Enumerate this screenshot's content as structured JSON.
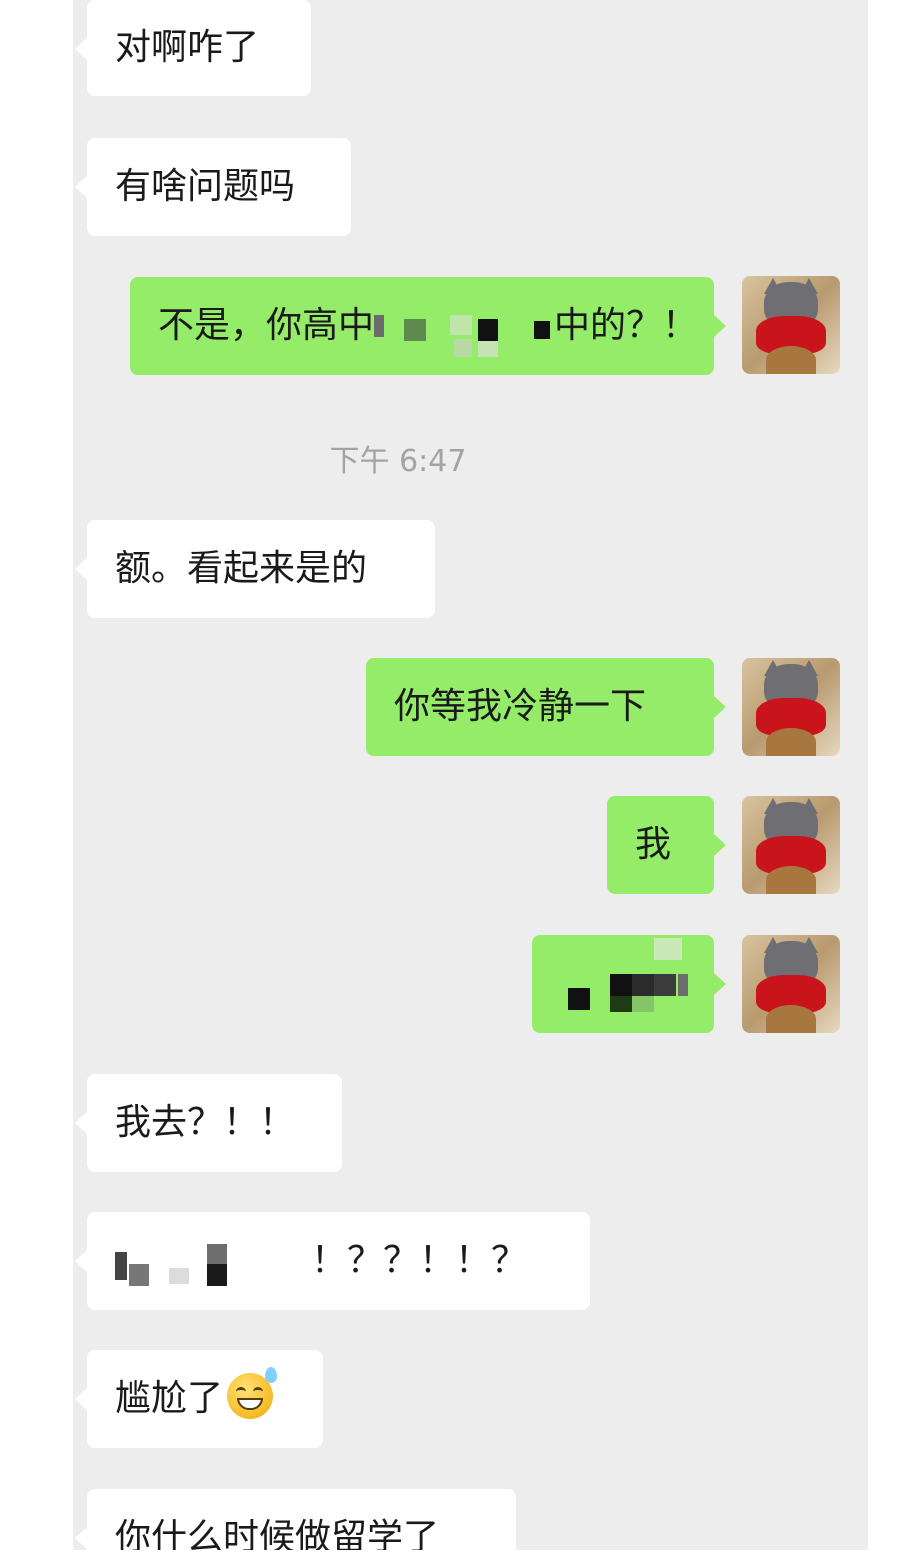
{
  "messages": [
    {
      "side": "in",
      "text": "对啊咋了"
    },
    {
      "side": "in",
      "text": "有啥问题吗"
    },
    {
      "side": "out",
      "text_before": "不是，你高中",
      "text_after": "中的？！"
    },
    {
      "side": "out",
      "text": "你等我冷静一下"
    },
    {
      "side": "out",
      "text": "我"
    },
    {
      "side": "in",
      "text": "我去？！！"
    },
    {
      "side": "in",
      "text_after": "！？？！！？"
    },
    {
      "side": "in",
      "text": "尴尬了",
      "emoji": "grinning-sweat-emoji"
    },
    {
      "side": "in",
      "text": "你什么时候做留学了"
    }
  ],
  "msg1": {
    "text": "额。看起来是的"
  },
  "timestamp": "下午 6:47",
  "colors": {
    "background": "#ededed",
    "incoming": "#ffffff",
    "outgoing": "#95ec69",
    "time_text": "#a3a3a3"
  },
  "avatar": {
    "icon": "cat-in-red-sweater-avatar"
  }
}
